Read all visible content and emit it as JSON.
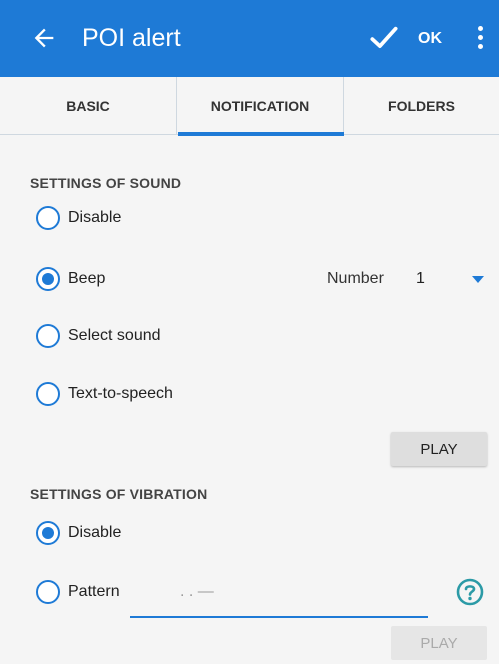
{
  "appbar": {
    "title": "POI alert",
    "ok_label": "OK",
    "icons": [
      "arrow-left-icon",
      "checkmark-icon",
      "more-vertical-icon"
    ],
    "color": "#1e7ad6"
  },
  "tabs": [
    {
      "label": "BASIC",
      "selected": false
    },
    {
      "label": "NOTIFICATION",
      "selected": true
    },
    {
      "label": "FOLDERS",
      "selected": false
    }
  ],
  "sound": {
    "header": "SETTINGS OF SOUND",
    "options": [
      {
        "label": "Disable",
        "checked": false
      },
      {
        "label": "Beep",
        "checked": true
      },
      {
        "label": "Select sound",
        "checked": false
      },
      {
        "label": "Text-to-speech",
        "checked": false
      }
    ],
    "number_label": "Number",
    "number_value": "1",
    "play_label": "PLAY"
  },
  "vibration": {
    "header": "SETTINGS OF VIBRATION",
    "options": [
      {
        "label": "Disable",
        "checked": true
      },
      {
        "label": "Pattern",
        "checked": false
      }
    ],
    "pattern_value": ". . —",
    "play_label": "PLAY",
    "play_enabled": false
  }
}
